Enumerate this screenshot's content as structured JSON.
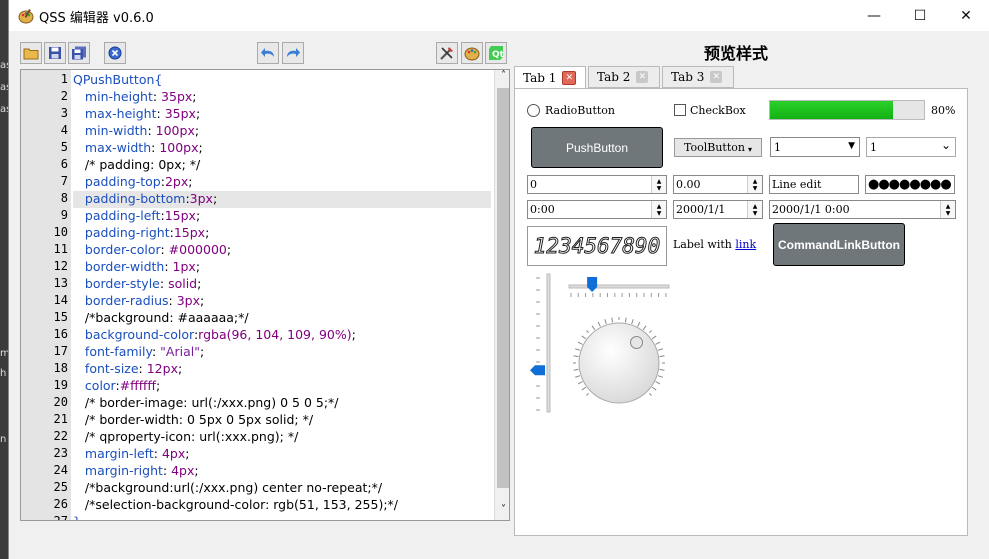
{
  "window": {
    "title": "QSS 编辑器 v0.6.0",
    "controls": {
      "minimize": "—",
      "maximize": "☐",
      "close": "✕"
    }
  },
  "background_window": {
    "fragments": [
      "as",
      "as",
      "as",
      "m",
      "h",
      "n"
    ]
  },
  "toolbar": {
    "left": [
      "open-icon",
      "save-icon",
      "save-as-icon",
      "stop-icon"
    ],
    "middle": [
      "undo-icon",
      "redo-icon"
    ],
    "right": [
      "tools-icon",
      "palette-icon",
      "qt-icon"
    ]
  },
  "editor": {
    "highlight_line": 8,
    "lines": [
      {
        "n": "1",
        "parts": [
          [
            "k",
            "QPushButton{"
          ]
        ]
      },
      {
        "n": "2",
        "parts": [
          [
            "k",
            "   min-height"
          ],
          [
            "c",
            ": "
          ],
          [
            "v",
            "35px"
          ],
          [
            "c",
            ";"
          ]
        ]
      },
      {
        "n": "3",
        "parts": [
          [
            "k",
            "   max-height"
          ],
          [
            "c",
            ": "
          ],
          [
            "v",
            "35px"
          ],
          [
            "c",
            ";"
          ]
        ]
      },
      {
        "n": "4",
        "parts": [
          [
            "k",
            "   min-width"
          ],
          [
            "c",
            ": "
          ],
          [
            "v",
            "100px"
          ],
          [
            "c",
            ";"
          ]
        ]
      },
      {
        "n": "5",
        "parts": [
          [
            "k",
            "   max-width"
          ],
          [
            "c",
            ": "
          ],
          [
            "v",
            "100px"
          ],
          [
            "c",
            ";"
          ]
        ]
      },
      {
        "n": "6",
        "parts": [
          [
            "c",
            "   /* padding: 0px; */"
          ]
        ]
      },
      {
        "n": "7",
        "parts": [
          [
            "k",
            "   padding-top"
          ],
          [
            "c",
            ":"
          ],
          [
            "v",
            "2px"
          ],
          [
            "c",
            ";"
          ]
        ]
      },
      {
        "n": "8",
        "parts": [
          [
            "k",
            "   padding-bottom"
          ],
          [
            "c",
            ":"
          ],
          [
            "v",
            "3px"
          ],
          [
            "c",
            ";"
          ]
        ]
      },
      {
        "n": "9",
        "parts": [
          [
            "k",
            "   padding-left"
          ],
          [
            "c",
            ":"
          ],
          [
            "v",
            "15px"
          ],
          [
            "c",
            ";"
          ]
        ]
      },
      {
        "n": "10",
        "parts": [
          [
            "k",
            "   padding-right"
          ],
          [
            "c",
            ":"
          ],
          [
            "v",
            "15px"
          ],
          [
            "c",
            ";"
          ]
        ]
      },
      {
        "n": "11",
        "parts": [
          [
            "k",
            "   border-color"
          ],
          [
            "c",
            ": "
          ],
          [
            "v",
            "#000000"
          ],
          [
            "c",
            ";"
          ]
        ]
      },
      {
        "n": "12",
        "parts": [
          [
            "k",
            "   border-width"
          ],
          [
            "c",
            ": "
          ],
          [
            "v",
            "1px"
          ],
          [
            "c",
            ";"
          ]
        ]
      },
      {
        "n": "13",
        "parts": [
          [
            "k",
            "   border-style"
          ],
          [
            "c",
            ": "
          ],
          [
            "v",
            "solid"
          ],
          [
            "c",
            ";"
          ]
        ]
      },
      {
        "n": "14",
        "parts": [
          [
            "k",
            "   border-radius"
          ],
          [
            "c",
            ": "
          ],
          [
            "v",
            "3px"
          ],
          [
            "c",
            ";"
          ]
        ]
      },
      {
        "n": "15",
        "parts": [
          [
            "c",
            "   /*background: #aaaaaa;*/"
          ]
        ]
      },
      {
        "n": "16",
        "parts": [
          [
            "k",
            "   background-color"
          ],
          [
            "c",
            ":"
          ],
          [
            "v",
            "rgba(96, 104, 109, 90%)"
          ],
          [
            "c",
            ";"
          ]
        ]
      },
      {
        "n": "17",
        "parts": [
          [
            "k",
            "   font-family"
          ],
          [
            "c",
            ": "
          ],
          [
            "s",
            "\"Arial\""
          ],
          [
            "c",
            ";"
          ]
        ]
      },
      {
        "n": "18",
        "parts": [
          [
            "k",
            "   font-size"
          ],
          [
            "c",
            ": "
          ],
          [
            "v",
            "12px"
          ],
          [
            "c",
            ";"
          ]
        ]
      },
      {
        "n": "19",
        "parts": [
          [
            "k",
            "   color"
          ],
          [
            "c",
            ":"
          ],
          [
            "v",
            "#ffffff"
          ],
          [
            "c",
            ";"
          ]
        ]
      },
      {
        "n": "20",
        "parts": [
          [
            "c",
            "   /* border-image: url(:/xxx.png) 0 5 0 5;*/"
          ]
        ]
      },
      {
        "n": "21",
        "parts": [
          [
            "c",
            "   /* border-width: 0 5px 0 5px solid; */"
          ]
        ]
      },
      {
        "n": "22",
        "parts": [
          [
            "c",
            "   /* qproperty-icon: url(:xxx.png); */"
          ]
        ]
      },
      {
        "n": "23",
        "parts": [
          [
            "k",
            "   margin-left"
          ],
          [
            "c",
            ": "
          ],
          [
            "v",
            "4px"
          ],
          [
            "c",
            ";"
          ]
        ]
      },
      {
        "n": "24",
        "parts": [
          [
            "k",
            "   margin-right"
          ],
          [
            "c",
            ": "
          ],
          [
            "v",
            "4px"
          ],
          [
            "c",
            ";"
          ]
        ]
      },
      {
        "n": "25",
        "parts": [
          [
            "c",
            "   /*background:url(:/xxx.png) center no-repeat;*/"
          ]
        ]
      },
      {
        "n": "26",
        "parts": [
          [
            "c",
            "   /*selection-background-color: rgb(51, 153, 255);*/"
          ]
        ]
      },
      {
        "n": "27",
        "parts": [
          [
            "k",
            "}"
          ]
        ]
      }
    ],
    "scroll_up": "˄",
    "scroll_down": "˅"
  },
  "preview": {
    "title": "预览样式",
    "tabs": [
      {
        "label": "Tab 1",
        "active": true
      },
      {
        "label": "Tab 2",
        "active": false
      },
      {
        "label": "Tab 3",
        "active": false
      }
    ],
    "tab_close": "✕",
    "radio_label": "RadioButton",
    "checkbox_label": "CheckBox",
    "progress_value": 80,
    "progress_text": "80%",
    "push_button": "PushButton",
    "tool_button": "ToolButton",
    "tool_button_arrow": "▾",
    "combo1_value": "1",
    "combo2_value": "1",
    "combo_arrow": "▼",
    "combo_arrow2": "⌄",
    "spin_int": "0",
    "spin_double": "0.00",
    "line_edit": "Line edit",
    "password": "●●●●●●●●",
    "time_edit": "0:00",
    "date_edit": "2000/1/1",
    "datetime_edit": "2000/1/1 0:00",
    "spin_up": "▲",
    "spin_down": "▼",
    "lcd_value": "1234567890",
    "label_prefix": "Label with ",
    "label_link": "link",
    "command_link": "CommandLinkButton",
    "vslider_value": 30,
    "hslider_value": 22,
    "dial_value": 65
  },
  "colors": {
    "progress": "#13b213",
    "accent": "#0f6fd6",
    "button_bg": "#60686d",
    "tab_close": "#e06a5a"
  }
}
